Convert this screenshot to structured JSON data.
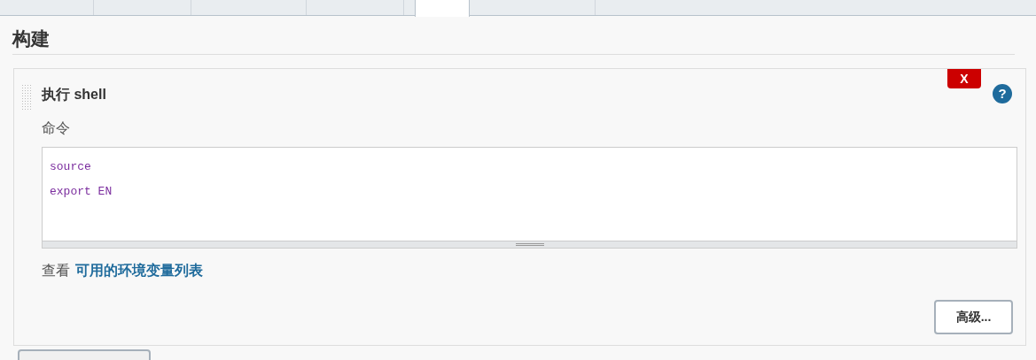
{
  "tabs": [
    {
      "selected": false
    },
    {
      "selected": false
    },
    {
      "selected": false
    },
    {
      "selected": false
    },
    {
      "selected": true
    },
    {
      "selected": false
    }
  ],
  "section_title": "构建",
  "build_step": {
    "title": "执行 shell",
    "delete_label": "X",
    "help": "?",
    "command_label": "命令",
    "command_lines": [
      "source",
      "export EN"
    ],
    "env_prefix": "查看",
    "env_link": "可用的环境变量列表",
    "advanced_button": "高级..."
  }
}
